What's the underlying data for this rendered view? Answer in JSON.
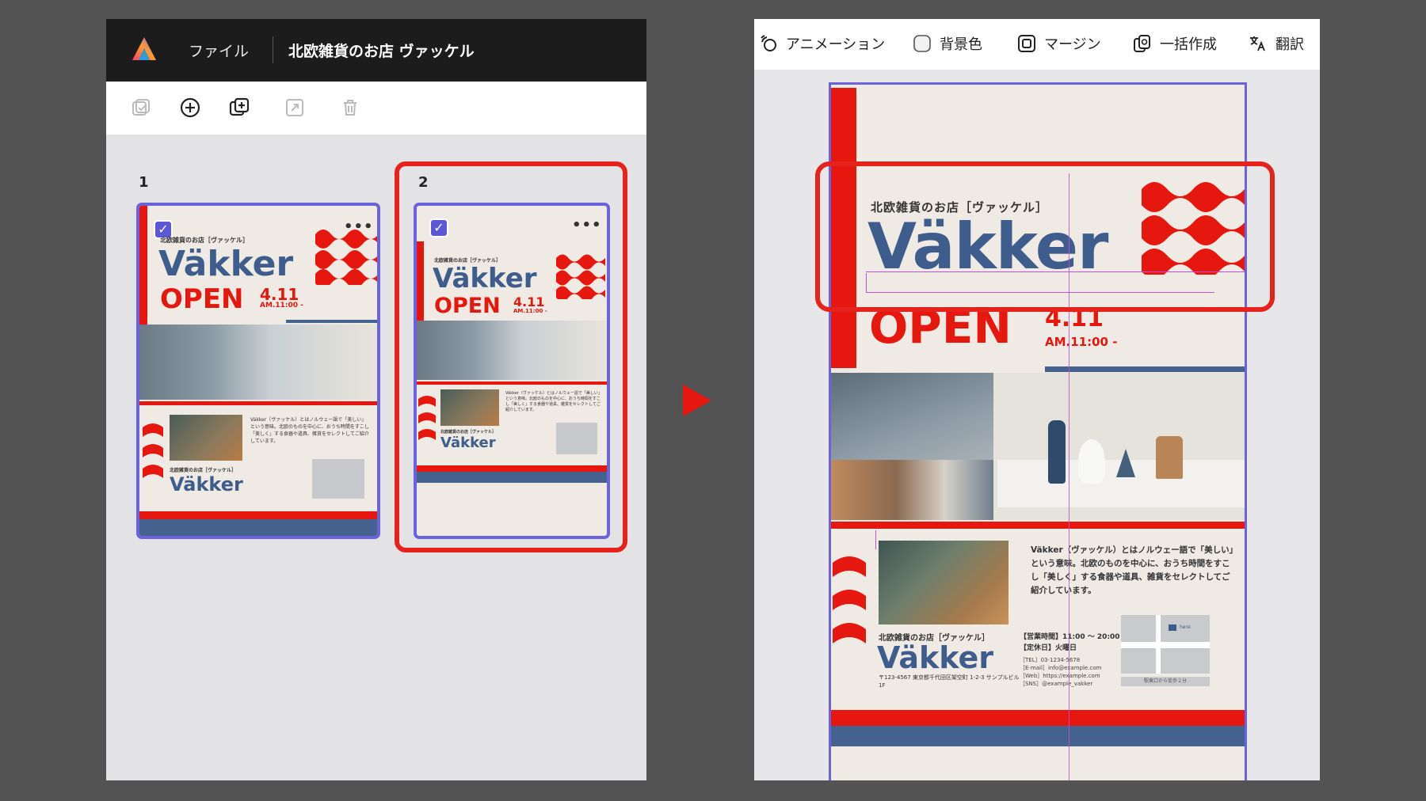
{
  "app": {
    "menu_file": "ファイル",
    "doc_title": "北欧雑貨のお店 ヴァッケル"
  },
  "toolbar_icons": [
    "select-all-icon",
    "add-page-icon",
    "duplicate-page-icon",
    "resize-icon",
    "trash-icon"
  ],
  "pages": [
    {
      "number": "1",
      "more": "•••"
    },
    {
      "number": "2",
      "more": "•••"
    }
  ],
  "editor_toolbar": [
    {
      "icon": "animation-icon",
      "label": "アニメーション"
    },
    {
      "icon": "background-color-icon",
      "label": "背景色"
    },
    {
      "icon": "margin-icon",
      "label": "マージン"
    },
    {
      "icon": "batch-create-icon",
      "label": "一括作成"
    },
    {
      "icon": "translate-icon",
      "label": "翻訳"
    }
  ],
  "poster": {
    "shop_label": "北欧雑貨のお店［ヴァッケル］",
    "brand": "Väkker",
    "open": "OPEN",
    "date": "4.11",
    "time": "AM.11:00 -",
    "description": "Väkker（ヴァッケル）とはノルウェー語で「美しい」という意味。北欧のものを中心に、おうち時間をすこし「美しく」する食器や道具、雑貨をセレクトしてご紹介しています。",
    "footer_shop": "北欧雑貨のお店［ヴァッケル］",
    "footer_brand": "Väkker",
    "address": "〒123-4567 東京都千代田区架空町 1-2-3 サンプルビル 1F",
    "hours": "【営業時間】11:00 ～ 20:00",
    "closed": "【定休日】火曜日",
    "tel": "［TEL］03-1234-5678",
    "email": "［E-mail］info@example.com",
    "web": "［Web］https://example.com",
    "sns": "［SNS］@example_vakker",
    "map_here": "here",
    "map_caption": "駅東口から徒歩２分"
  },
  "colors": {
    "accent": "#e5170f",
    "navy": "#45628f",
    "selection": "#6a63dd",
    "guide": "#c24fd8"
  }
}
